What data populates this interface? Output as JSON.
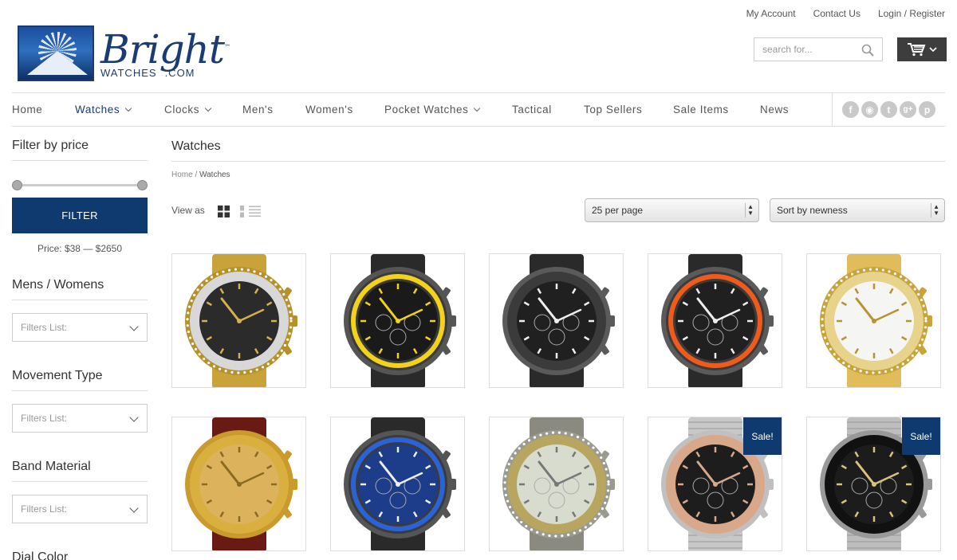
{
  "toplinks": {
    "account": "My Account",
    "contact": "Contact Us",
    "login": "Login / Register"
  },
  "logo": {
    "name": "Bright",
    "tm": "™",
    "sub1": "WATCHES",
    "sub2": ".COM"
  },
  "search": {
    "placeholder": "search for..."
  },
  "nav": {
    "items": [
      {
        "label": "Home",
        "dropdown": false
      },
      {
        "label": "Watches",
        "dropdown": true,
        "active": true
      },
      {
        "label": "Clocks",
        "dropdown": true
      },
      {
        "label": "Men's",
        "dropdown": false
      },
      {
        "label": "Women's",
        "dropdown": false
      },
      {
        "label": "Pocket Watches",
        "dropdown": true
      },
      {
        "label": "Tactical",
        "dropdown": false
      },
      {
        "label": "Top Sellers",
        "dropdown": false
      },
      {
        "label": "Sale Items",
        "dropdown": false
      },
      {
        "label": "News",
        "dropdown": false
      }
    ],
    "social": [
      "facebook-icon",
      "rss-icon",
      "twitter-icon",
      "google-plus-icon",
      "pinterest-icon"
    ],
    "social_glyphs": [
      "f",
      "◉",
      "t",
      "g+",
      "p"
    ]
  },
  "sidebar": {
    "price_heading": "Filter by price",
    "filter_button": "FILTER",
    "price_text": "Price: $38 — $2650",
    "sections": [
      {
        "heading": "Mens / Womens",
        "placeholder": "Filters List:"
      },
      {
        "heading": "Movement Type",
        "placeholder": "Filters List:"
      },
      {
        "heading": "Band Material",
        "placeholder": "Filters List:"
      },
      {
        "heading": "Dial Color"
      }
    ]
  },
  "main": {
    "title": "Watches",
    "breadcrumb": {
      "home": "Home",
      "sep": " / ",
      "current": "Watches"
    },
    "view_as": "View as",
    "per_page": "25 per page",
    "sort": "Sort by newness",
    "sale_label": "Sale!",
    "products": [
      {
        "style": "gold-crystal",
        "sale": false
      },
      {
        "style": "black-yellow",
        "sale": false
      },
      {
        "style": "black-chrono",
        "sale": false
      },
      {
        "style": "black-orange",
        "sale": false
      },
      {
        "style": "gold-ladies",
        "sale": false
      },
      {
        "style": "gold-leather",
        "sale": false
      },
      {
        "style": "black-blue",
        "sale": false
      },
      {
        "style": "titanium-gold",
        "sale": false
      },
      {
        "style": "rose-chrono",
        "sale": true
      },
      {
        "style": "black-bracelet",
        "sale": true
      }
    ]
  },
  "colors": {
    "brand": "#0e3a6f",
    "nav_active": "#1a3b73",
    "cart": "#3d3d3d"
  }
}
